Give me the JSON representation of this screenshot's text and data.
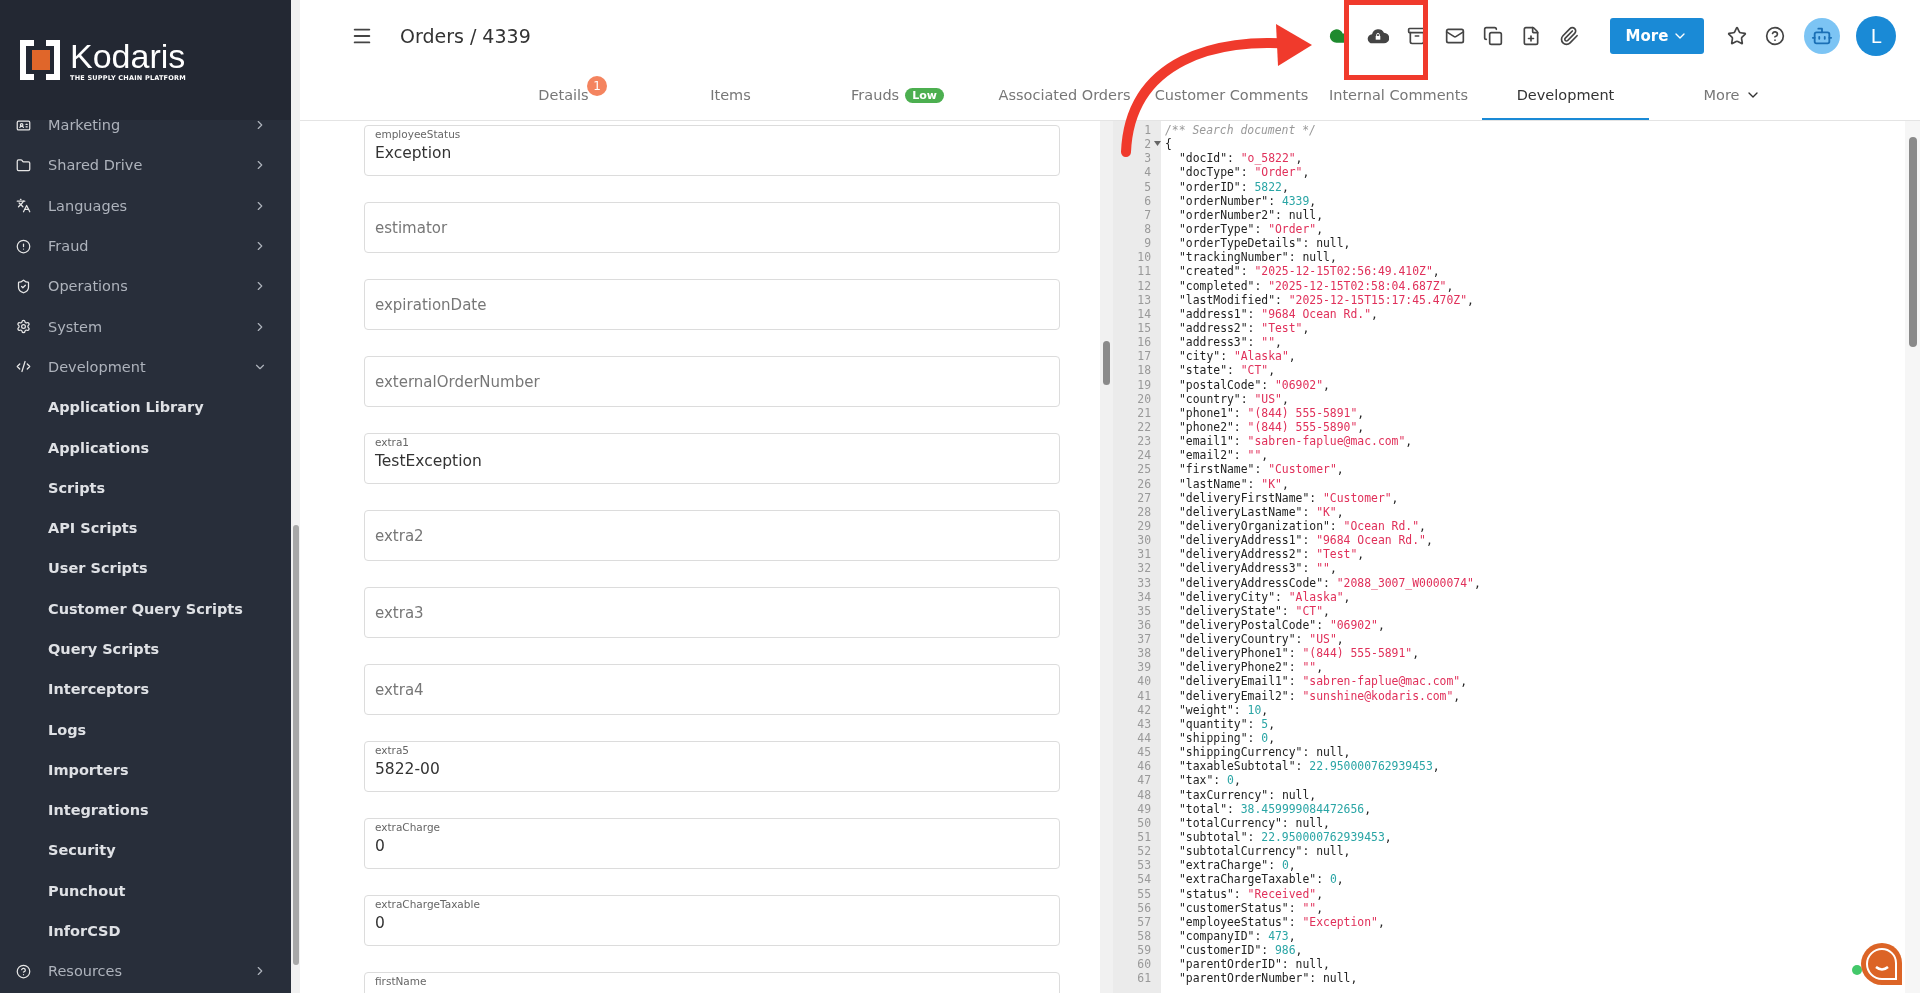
{
  "brand": {
    "name": "Kodaris",
    "tagline": "THE SUPPLY CHAIN PLATFORM"
  },
  "sidebar": {
    "items": [
      {
        "label": "Marketing",
        "expanded": false
      },
      {
        "label": "Shared Drive",
        "expanded": false
      },
      {
        "label": "Languages",
        "expanded": false
      },
      {
        "label": "Fraud",
        "expanded": false
      },
      {
        "label": "Operations",
        "expanded": false
      },
      {
        "label": "System",
        "expanded": false
      },
      {
        "label": "Development",
        "expanded": true,
        "children": [
          {
            "label": "Application Library"
          },
          {
            "label": "Applications"
          },
          {
            "label": "Scripts"
          },
          {
            "label": "API Scripts"
          },
          {
            "label": "User Scripts"
          },
          {
            "label": "Customer Query Scripts"
          },
          {
            "label": "Query Scripts"
          },
          {
            "label": "Interceptors"
          },
          {
            "label": "Logs"
          },
          {
            "label": "Importers"
          },
          {
            "label": "Integrations"
          },
          {
            "label": "Security"
          },
          {
            "label": "Punchout"
          },
          {
            "label": "InforCSD"
          }
        ]
      },
      {
        "label": "Resources",
        "expanded": false
      }
    ]
  },
  "header": {
    "title": "Orders / 4339",
    "more_button": "More",
    "avatar": "L"
  },
  "tabs": [
    {
      "label": "Details",
      "selected": false,
      "count_badge": "1"
    },
    {
      "label": "Items",
      "selected": false
    },
    {
      "label": "Frauds",
      "selected": false,
      "level_badge": "Low"
    },
    {
      "label": "Associated Orders",
      "selected": false
    },
    {
      "label": "Customer Comments",
      "selected": false
    },
    {
      "label": "Internal Comments",
      "selected": false
    },
    {
      "label": "Development",
      "selected": true
    },
    {
      "label": "More",
      "selected": false,
      "dropdown": true
    }
  ],
  "form_fields": [
    {
      "label": "employeeStatus",
      "value": "Exception"
    },
    {
      "placeholder": "estimator"
    },
    {
      "placeholder": "expirationDate"
    },
    {
      "placeholder": "externalOrderNumber"
    },
    {
      "label": "extra1",
      "value": "TestException"
    },
    {
      "placeholder": "extra2"
    },
    {
      "placeholder": "extra3"
    },
    {
      "placeholder": "extra4"
    },
    {
      "label": "extra5",
      "value": "5822-00"
    },
    {
      "label": "extraCharge",
      "value": "0"
    },
    {
      "label": "extraChargeTaxable",
      "value": "0"
    },
    {
      "label": "firstName"
    }
  ],
  "editor": {
    "lines": [
      {
        "n": "1",
        "kind": "comment",
        "text": "/** Search document */"
      },
      {
        "n": "2",
        "kind": "brace",
        "text": "{",
        "foldable": true
      },
      {
        "n": "3",
        "kind": "string",
        "key": "\"docId\": ",
        "value": "\"o_5822\"",
        "tail": ","
      },
      {
        "n": "4",
        "kind": "string",
        "key": "\"docType\": ",
        "value": "\"Order\"",
        "tail": ","
      },
      {
        "n": "5",
        "kind": "number",
        "key": "\"orderID\": ",
        "value": "5822",
        "tail": ","
      },
      {
        "n": "6",
        "kind": "number",
        "key": "\"orderNumber\": ",
        "value": "4339",
        "tail": ","
      },
      {
        "n": "7",
        "kind": "null",
        "key": "\"orderNumber2\": ",
        "value": "null",
        "tail": ","
      },
      {
        "n": "8",
        "kind": "string",
        "key": "\"orderType\": ",
        "value": "\"Order\"",
        "tail": ","
      },
      {
        "n": "9",
        "kind": "null",
        "key": "\"orderTypeDetails\": ",
        "value": "null",
        "tail": ","
      },
      {
        "n": "10",
        "kind": "null",
        "key": "\"trackingNumber\": ",
        "value": "null",
        "tail": ","
      },
      {
        "n": "11",
        "kind": "string",
        "key": "\"created\": ",
        "value": "\"2025-12-15T02:56:49.410Z\"",
        "tail": ","
      },
      {
        "n": "12",
        "kind": "string",
        "key": "\"completed\": ",
        "value": "\"2025-12-15T02:58:04.687Z\"",
        "tail": ","
      },
      {
        "n": "13",
        "kind": "string",
        "key": "\"lastModified\": ",
        "value": "\"2025-12-15T15:17:45.470Z\"",
        "tail": ","
      },
      {
        "n": "14",
        "kind": "string",
        "key": "\"address1\": ",
        "value": "\"9684 Ocean Rd.\"",
        "tail": ","
      },
      {
        "n": "15",
        "kind": "string",
        "key": "\"address2\": ",
        "value": "\"Test\"",
        "tail": ","
      },
      {
        "n": "16",
        "kind": "string",
        "key": "\"address3\": ",
        "value": "\"\"",
        "tail": ","
      },
      {
        "n": "17",
        "kind": "string",
        "key": "\"city\": ",
        "value": "\"Alaska\"",
        "tail": ","
      },
      {
        "n": "18",
        "kind": "string",
        "key": "\"state\": ",
        "value": "\"CT\"",
        "tail": ","
      },
      {
        "n": "19",
        "kind": "string",
        "key": "\"postalCode\": ",
        "value": "\"06902\"",
        "tail": ","
      },
      {
        "n": "20",
        "kind": "string",
        "key": "\"country\": ",
        "value": "\"US\"",
        "tail": ","
      },
      {
        "n": "21",
        "kind": "string",
        "key": "\"phone1\": ",
        "value": "\"(844) 555-5891\"",
        "tail": ","
      },
      {
        "n": "22",
        "kind": "string",
        "key": "\"phone2\": ",
        "value": "\"(844) 555-5890\"",
        "tail": ","
      },
      {
        "n": "23",
        "kind": "string",
        "key": "\"email1\": ",
        "value": "\"sabren-faplue@mac.com\"",
        "tail": ","
      },
      {
        "n": "24",
        "kind": "string",
        "key": "\"email2\": ",
        "value": "\"\"",
        "tail": ","
      },
      {
        "n": "25",
        "kind": "string",
        "key": "\"firstName\": ",
        "value": "\"Customer\"",
        "tail": ","
      },
      {
        "n": "26",
        "kind": "string",
        "key": "\"lastName\": ",
        "value": "\"K\"",
        "tail": ","
      },
      {
        "n": "27",
        "kind": "string",
        "key": "\"deliveryFirstName\": ",
        "value": "\"Customer\"",
        "tail": ","
      },
      {
        "n": "28",
        "kind": "string",
        "key": "\"deliveryLastName\": ",
        "value": "\"K\"",
        "tail": ","
      },
      {
        "n": "29",
        "kind": "string",
        "key": "\"deliveryOrganization\": ",
        "value": "\"Ocean Rd.\"",
        "tail": ","
      },
      {
        "n": "30",
        "kind": "string",
        "key": "\"deliveryAddress1\": ",
        "value": "\"9684 Ocean Rd.\"",
        "tail": ","
      },
      {
        "n": "31",
        "kind": "string",
        "key": "\"deliveryAddress2\": ",
        "value": "\"Test\"",
        "tail": ","
      },
      {
        "n": "32",
        "kind": "string",
        "key": "\"deliveryAddress3\": ",
        "value": "\"\"",
        "tail": ","
      },
      {
        "n": "33",
        "kind": "string",
        "key": "\"deliveryAddressCode\": ",
        "value": "\"2088_3007_W0000074\"",
        "tail": ","
      },
      {
        "n": "34",
        "kind": "string",
        "key": "\"deliveryCity\": ",
        "value": "\"Alaska\"",
        "tail": ","
      },
      {
        "n": "35",
        "kind": "string",
        "key": "\"deliveryState\": ",
        "value": "\"CT\"",
        "tail": ","
      },
      {
        "n": "36",
        "kind": "string",
        "key": "\"deliveryPostalCode\": ",
        "value": "\"06902\"",
        "tail": ","
      },
      {
        "n": "37",
        "kind": "string",
        "key": "\"deliveryCountry\": ",
        "value": "\"US\"",
        "tail": ","
      },
      {
        "n": "38",
        "kind": "string",
        "key": "\"deliveryPhone1\": ",
        "value": "\"(844) 555-5891\"",
        "tail": ","
      },
      {
        "n": "39",
        "kind": "string",
        "key": "\"deliveryPhone2\": ",
        "value": "\"\"",
        "tail": ","
      },
      {
        "n": "40",
        "kind": "string",
        "key": "\"deliveryEmail1\": ",
        "value": "\"sabren-faplue@mac.com\"",
        "tail": ","
      },
      {
        "n": "41",
        "kind": "string",
        "key": "\"deliveryEmail2\": ",
        "value": "\"sunshine@kodaris.com\"",
        "tail": ","
      },
      {
        "n": "42",
        "kind": "number",
        "key": "\"weight\": ",
        "value": "10",
        "tail": ","
      },
      {
        "n": "43",
        "kind": "number",
        "key": "\"quantity\": ",
        "value": "5",
        "tail": ","
      },
      {
        "n": "44",
        "kind": "number",
        "key": "\"shipping\": ",
        "value": "0",
        "tail": ","
      },
      {
        "n": "45",
        "kind": "null",
        "key": "\"shippingCurrency\": ",
        "value": "null",
        "tail": ","
      },
      {
        "n": "46",
        "kind": "number",
        "key": "\"taxableSubtotal\": ",
        "value": "22.950000762939453",
        "tail": ","
      },
      {
        "n": "47",
        "kind": "number",
        "key": "\"tax\": ",
        "value": "0",
        "tail": ","
      },
      {
        "n": "48",
        "kind": "null",
        "key": "\"taxCurrency\": ",
        "value": "null",
        "tail": ","
      },
      {
        "n": "49",
        "kind": "number",
        "key": "\"total\": ",
        "value": "38.459999084472656",
        "tail": ","
      },
      {
        "n": "50",
        "kind": "null",
        "key": "\"totalCurrency\": ",
        "value": "null",
        "tail": ","
      },
      {
        "n": "51",
        "kind": "number",
        "key": "\"subtotal\": ",
        "value": "22.950000762939453",
        "tail": ","
      },
      {
        "n": "52",
        "kind": "null",
        "key": "\"subtotalCurrency\": ",
        "value": "null",
        "tail": ","
      },
      {
        "n": "53",
        "kind": "number",
        "key": "\"extraCharge\": ",
        "value": "0",
        "tail": ","
      },
      {
        "n": "54",
        "kind": "number",
        "key": "\"extraChargeTaxable\": ",
        "value": "0",
        "tail": ","
      },
      {
        "n": "55",
        "kind": "string",
        "key": "\"status\": ",
        "value": "\"Received\"",
        "tail": ","
      },
      {
        "n": "56",
        "kind": "string",
        "key": "\"customerStatus\": ",
        "value": "\"\"",
        "tail": ","
      },
      {
        "n": "57",
        "kind": "string",
        "key": "\"employeeStatus\": ",
        "value": "\"Exception\"",
        "tail": ","
      },
      {
        "n": "58",
        "kind": "number",
        "key": "\"companyID\": ",
        "value": "473",
        "tail": ","
      },
      {
        "n": "59",
        "kind": "number",
        "key": "\"customerID\": ",
        "value": "986",
        "tail": ","
      },
      {
        "n": "60",
        "kind": "null",
        "key": "\"parentOrderID\": ",
        "value": "null",
        "tail": ","
      },
      {
        "n": "61",
        "kind": "null",
        "key": "\"parentOrderNumber\": ",
        "value": "null",
        "tail": ","
      }
    ]
  }
}
